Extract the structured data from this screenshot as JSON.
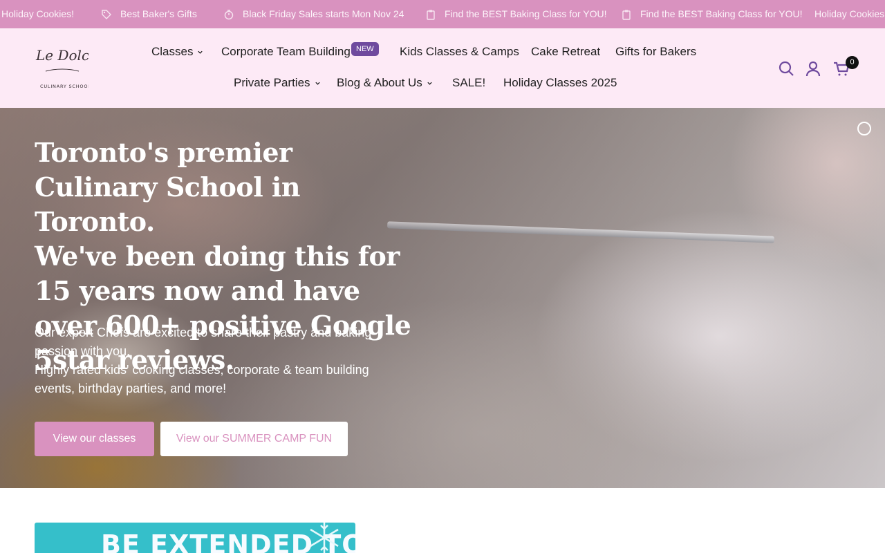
{
  "announcement": {
    "items": [
      {
        "text": "Holiday Cookies!",
        "icon": ""
      },
      {
        "text": "Best Baker's Gifts",
        "icon": "tag-icon"
      },
      {
        "text": "Black Friday Sales starts Mon Nov 24",
        "icon": "timer-icon"
      },
      {
        "text": "Find the BEST Baking Class for YOU!",
        "icon": "clipboard-icon"
      },
      {
        "text": "Find the BEST Baking Class for YOU!",
        "icon": "clipboard-icon"
      },
      {
        "text": "Holiday Cookies!",
        "icon": ""
      }
    ]
  },
  "logo": {
    "line1": "Le Dolci",
    "line2": "CULINARY SCHOOL"
  },
  "nav": {
    "row1": [
      {
        "label": "Classes",
        "has_dropdown": true
      },
      {
        "label": "Corporate Team Building",
        "badge": "NEW"
      },
      {
        "label": "Kids Classes & Camps"
      },
      {
        "label": "Cake Retreat"
      },
      {
        "label": "Gifts for Bakers"
      }
    ],
    "row2": [
      {
        "label": "Private Parties",
        "has_dropdown": true
      },
      {
        "label": "Blog & About Us",
        "has_dropdown": true
      },
      {
        "label": "SALE!"
      },
      {
        "label": "Holiday Classes 2025"
      }
    ]
  },
  "header_icons": {
    "search": "search-icon",
    "account": "account-icon",
    "cart": "cart-icon",
    "cart_count": "0"
  },
  "hero": {
    "title_line1": "Toronto's premier Culinary School in Toronto.",
    "title_line2": "We've been doing this for 15 years now and have over 600+ positive Google 5star reviews.",
    "text_line1": "Our expert Chefs are excited to share their pastry and baking passion with you.",
    "text_line2": "Highly rated kids' cooking classes, corporate & team building events, birthday parties, and more!",
    "btn_primary": "View our classes",
    "btn_secondary": "View our SUMMER CAMP FUN"
  },
  "promo": {
    "text": "BE EXTENDED TO"
  },
  "colors": {
    "brand_pink": "#d992bf",
    "header_bg": "#fdeaf6",
    "badge_purple": "#6f4a9e",
    "promo_teal": "#35bfca"
  }
}
